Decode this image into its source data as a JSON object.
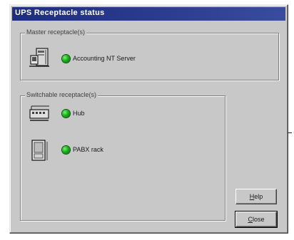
{
  "window": {
    "title": "UPS Receptacle status"
  },
  "master_group": {
    "legend": "Master receptacle(s)",
    "items": [
      {
        "label": "Accounting NT Server",
        "icon": "server-icon",
        "status": "on"
      }
    ]
  },
  "switchable_group": {
    "legend": "Switchable receptacle(s)",
    "items": [
      {
        "label": "Hub",
        "icon": "hub-icon",
        "status": "on"
      },
      {
        "label": "PABX rack",
        "icon": "rack-icon",
        "status": "on"
      }
    ]
  },
  "buttons": {
    "help": {
      "accel": "H",
      "rest": "elp"
    },
    "close": {
      "accel": "C",
      "rest": "lose"
    }
  },
  "colors": {
    "titlebar": "#2a3a8c",
    "dialog_face": "#c8c8c8",
    "status_on": "#18b018"
  }
}
